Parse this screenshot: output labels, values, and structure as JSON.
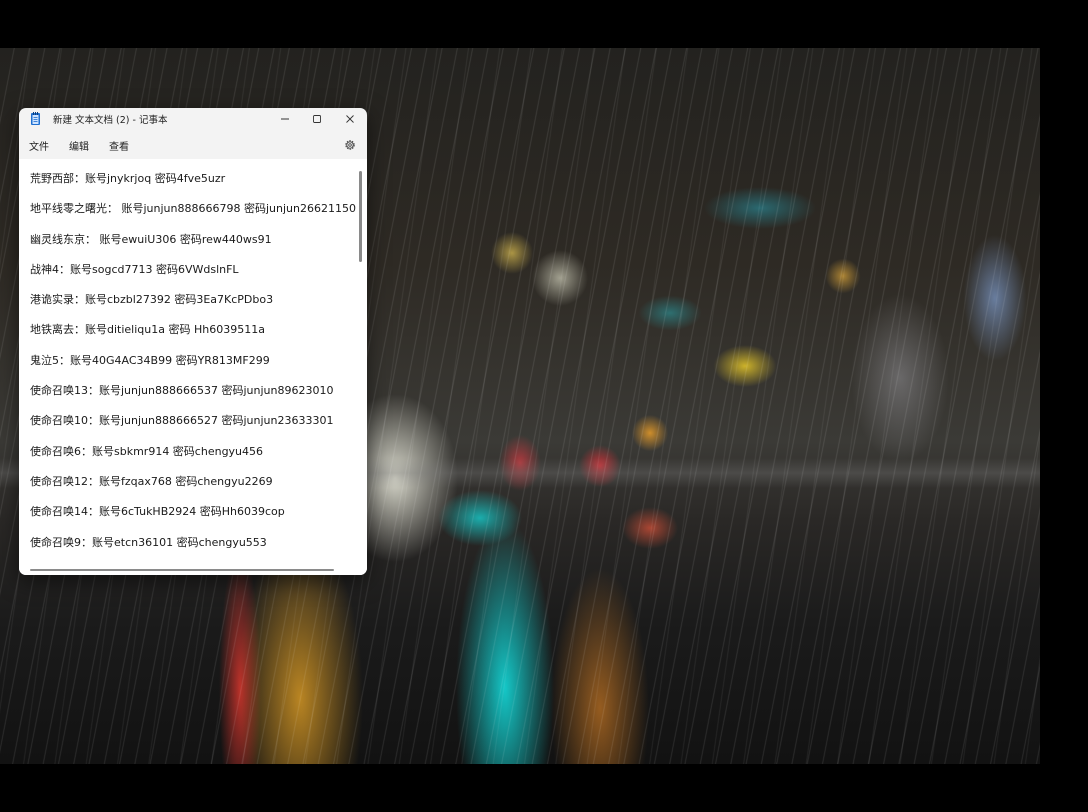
{
  "window": {
    "title": "新建 文本文档 (2) - 记事本",
    "app_icon": "notepad-icon",
    "controls": [
      "minimize-icon",
      "maximize-icon",
      "close-icon"
    ]
  },
  "menu": {
    "items": [
      {
        "label": "文件"
      },
      {
        "label": "编辑"
      },
      {
        "label": "查看"
      }
    ],
    "settings_icon": "gear-icon"
  },
  "editor": {
    "lines": [
      "荒野西部：账号jnykrjoq 密码4fve5uzr",
      "地平线零之曙光： 账号junjun888666798 密码junjun26621150",
      "幽灵线东京： 账号ewuiU306 密码rew440ws91",
      "战神4：账号sogcd7713 密码6VWdslnFL",
      "港诡实录：账号cbzbl27392 密码3Ea7KcPDbo3",
      "地铁离去：账号ditieliqu1a 密码 Hh6039511a",
      "鬼泣5：账号40G4AC34B99 密码YR813MF299",
      "使命召唤13：账号junjun888666537 密码junjun89623010",
      "使命召唤10：账号junjun888666527 密码junjun23633301",
      "使命召唤6：账号sbkmr914 密码chengyu456",
      "使命召唤12：账号fzqax768 密码chengyu2269",
      "使命召唤14：账号6cTukHB2924 密码Hh6039cop",
      "使命召唤9：账号etcn36101 密码chengyu553"
    ]
  },
  "colors": {
    "window_bg": "#f3f3f3",
    "editor_bg": "#ffffff",
    "text": "#1a1a1a",
    "icon_blue": "#1e6fd1"
  }
}
